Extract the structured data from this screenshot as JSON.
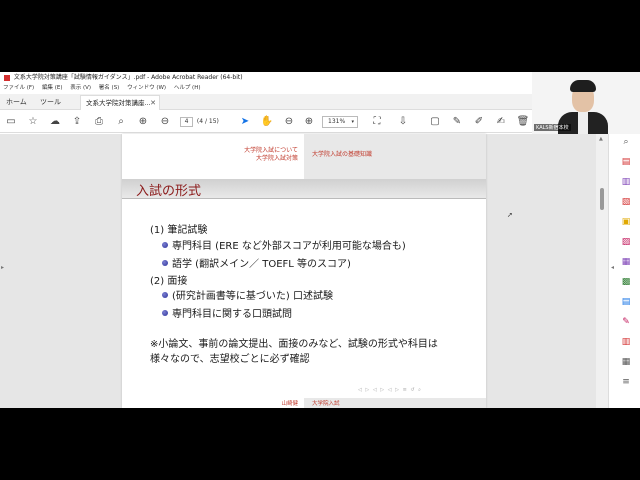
{
  "window": {
    "title": "文系大学院対策講座「試験情報ガイダンス」.pdf - Adobe Acrobat Reader (64-bit)"
  },
  "menu": [
    "ファイル (F)",
    "編集 (E)",
    "表示 (V)",
    "署名 (S)",
    "ウィンドウ (W)",
    "ヘルプ (H)"
  ],
  "tabs": {
    "home": "ホーム",
    "tools": "ツール",
    "document": "文系大学院対策講座..."
  },
  "toolbar": {
    "page_current": "4",
    "page_total": "(4 / 15)",
    "zoom": "131%"
  },
  "slide": {
    "header_left_1": "大学院入試について",
    "header_left_2": "大学院入試対策",
    "header_right": "大学院入試の基礎知識",
    "title": "入試の形式",
    "items": {
      "h1": "(1) 筆記試験",
      "b1": "専門科目 (ERE など外部スコアが利用可能な場合も)",
      "b2": "語学 (翻訳メイン／ TOEFL 等のスコア)",
      "h2": "(2) 面接",
      "b3": "(研究計画書等に基づいた) 口述試験",
      "b4": "専門科目に関する口頭試問",
      "note1": "※小論文、事前の論文提出、面接のみなど、試験の形式や科目は",
      "note2": "様々なので、志望校ごとに必ず確認"
    },
    "footer_left": "山崎健",
    "footer_right": "大学院入試"
  },
  "webcam": {
    "label": "KALS新宿本校"
  },
  "colors": {
    "accent": "#1473e6",
    "slide_red": "#c0392b",
    "title_red": "#8b1a1a",
    "bullet_blue": "#2e339b"
  }
}
